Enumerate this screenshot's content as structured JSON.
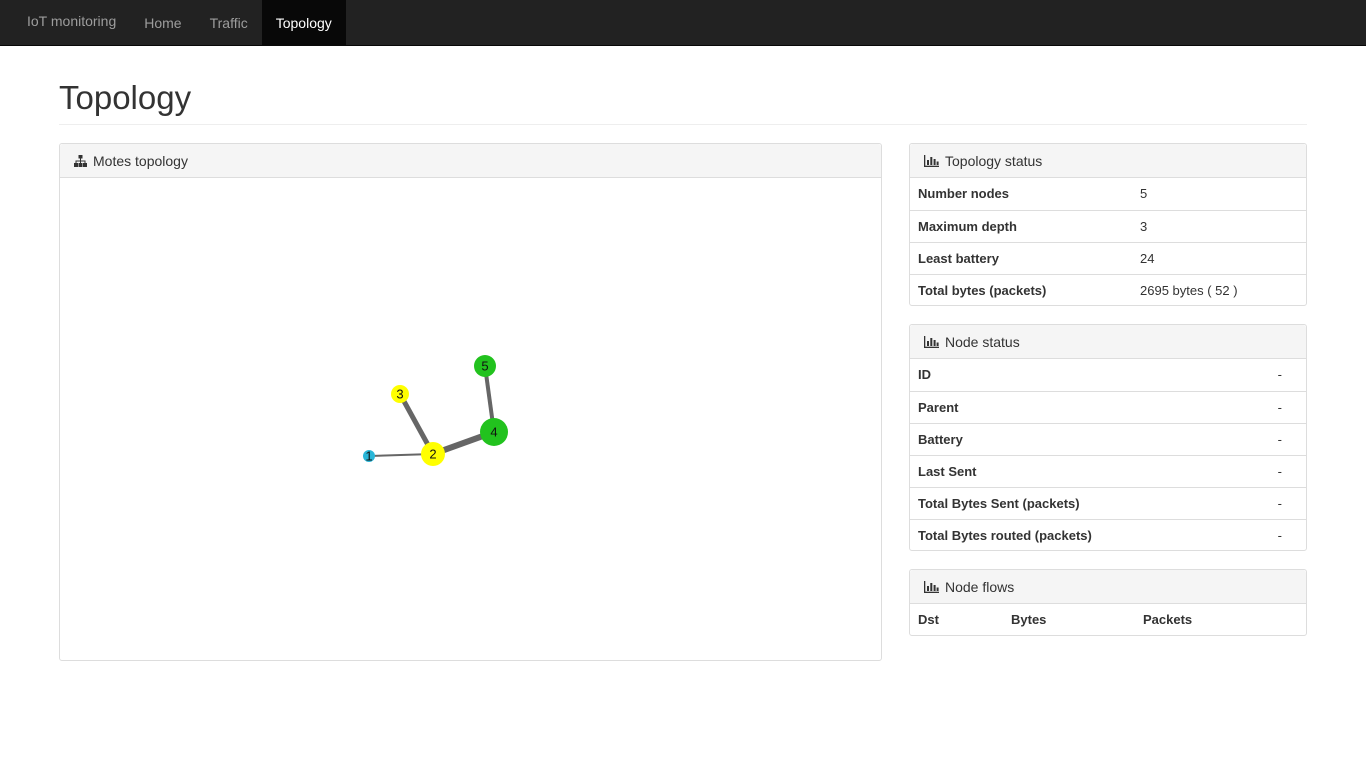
{
  "nav": {
    "brand": "IoT monitoring",
    "items": [
      {
        "label": "Home"
      },
      {
        "label": "Traffic"
      },
      {
        "label": "Topology"
      }
    ]
  },
  "page": {
    "title": "Topology"
  },
  "topology_panel": {
    "title": "Motes topology",
    "nodes": [
      {
        "id": "1",
        "color": "#29b6d8"
      },
      {
        "id": "2",
        "color": "#ffff00"
      },
      {
        "id": "3",
        "color": "#ffff00"
      },
      {
        "id": "4",
        "color": "#22c21e"
      },
      {
        "id": "5",
        "color": "#22c21e"
      }
    ],
    "edges": [
      {
        "from": "1",
        "to": "2"
      },
      {
        "from": "2",
        "to": "3"
      },
      {
        "from": "2",
        "to": "4"
      },
      {
        "from": "4",
        "to": "5"
      }
    ]
  },
  "topology_status": {
    "title": "Topology status",
    "rows": [
      {
        "key": "Number nodes",
        "value": "5"
      },
      {
        "key": "Maximum depth",
        "value": "3"
      },
      {
        "key": "Least battery",
        "value": "24"
      },
      {
        "key": "Total bytes (packets)",
        "value": "2695 bytes ( 52 )"
      }
    ]
  },
  "node_status": {
    "title": "Node status",
    "rows": [
      {
        "key": "ID",
        "value": "-"
      },
      {
        "key": "Parent",
        "value": "-"
      },
      {
        "key": "Battery",
        "value": "-"
      },
      {
        "key": "Last Sent",
        "value": "-"
      },
      {
        "key": "Total Bytes Sent (packets)",
        "value": "-"
      },
      {
        "key": "Total Bytes routed (packets)",
        "value": "-"
      }
    ]
  },
  "node_flows": {
    "title": "Node flows",
    "columns": [
      "Dst",
      "Bytes",
      "Packets"
    ]
  },
  "colors": {
    "navbar": "#222222",
    "edge": "#666666"
  }
}
